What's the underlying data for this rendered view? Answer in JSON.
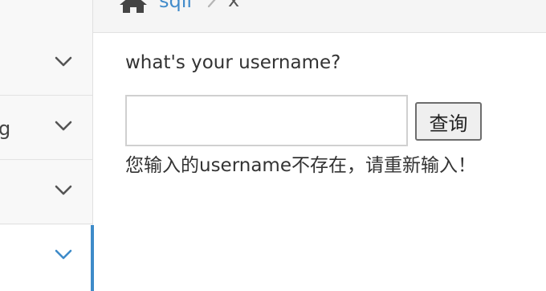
{
  "breadcrumb": {
    "home_icon": "home-icon",
    "link": "sqli",
    "current": "x"
  },
  "sidebar": {
    "items": [
      {
        "label": ""
      },
      {
        "label": "g"
      },
      {
        "label": ""
      },
      {
        "label": ""
      }
    ],
    "active_color": "#3e8bc9"
  },
  "form": {
    "question": "what's your username?",
    "username_value": "",
    "button_label": "查询",
    "message": "您输入的username不存在，请重新输入！"
  },
  "colors": {
    "link": "#428bca",
    "chevron": "#555555",
    "chevron_active": "#3e8bc9"
  }
}
